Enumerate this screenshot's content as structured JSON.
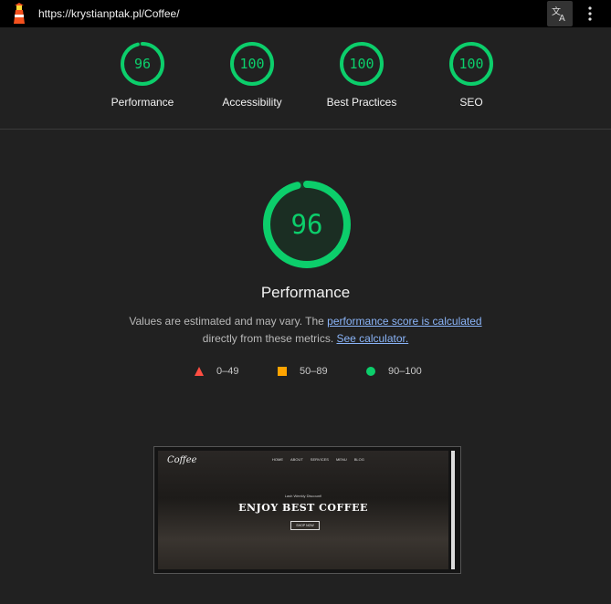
{
  "browser": {
    "url": "https://krystianptak.pl/Coffee/",
    "logo_icon": "lighthouse-icon",
    "translate_icon": "translate-icon",
    "menu_icon": "more-vert-icon"
  },
  "categories": [
    {
      "score": "96",
      "label": "Performance",
      "fraction": 0.96
    },
    {
      "score": "100",
      "label": "Accessibility",
      "fraction": 1.0
    },
    {
      "score": "100",
      "label": "Best Practices",
      "fraction": 1.0
    },
    {
      "score": "100",
      "label": "SEO",
      "fraction": 1.0
    }
  ],
  "main": {
    "score": "96",
    "fraction": 0.96,
    "title": "Performance",
    "desc_text1": "Values are estimated and may vary. The ",
    "desc_link1": "performance score is calculated",
    "desc_text2": "directly from these metrics. ",
    "desc_link2": "See calculator."
  },
  "legend": [
    {
      "icon": "triangle-fail-icon",
      "range": "0–49",
      "color": "#ff4e42"
    },
    {
      "icon": "square-average-icon",
      "range": "50–89",
      "color": "#ffa400"
    },
    {
      "icon": "circle-pass-icon",
      "range": "90–100",
      "color": "#0cce6b"
    }
  ],
  "colors": {
    "pass": "#0cce6b",
    "pass_bg": "#1b3b2a"
  },
  "screenshot": {
    "logo": "Coffee",
    "nav": [
      "HOME",
      "ABOUT",
      "SERVICES",
      "MENU",
      "BLOG"
    ],
    "tagline": "Lash Weekly Discount!",
    "heading": "ENJOY BEST COFFEE",
    "button": "SHOP NOW"
  }
}
